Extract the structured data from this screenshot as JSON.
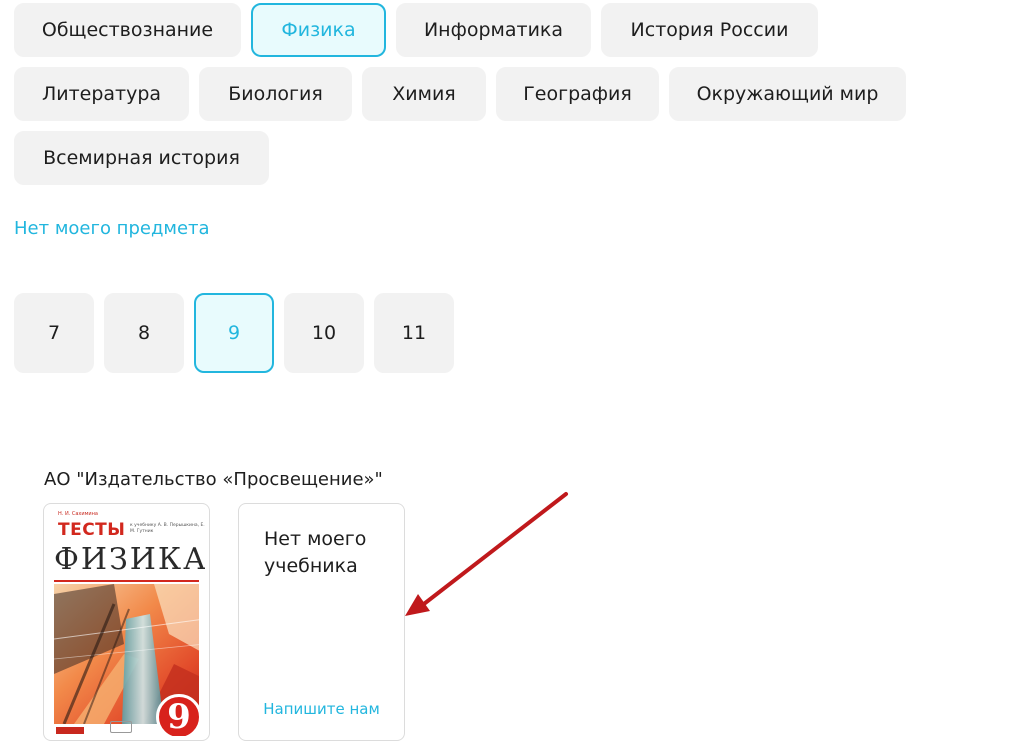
{
  "subjects": [
    {
      "label": "Обществознание",
      "active": false
    },
    {
      "label": "Физика",
      "active": true
    },
    {
      "label": "Информатика",
      "active": false
    },
    {
      "label": "История России",
      "active": false
    },
    {
      "label": "Литература",
      "active": false
    },
    {
      "label": "Биология",
      "active": false
    },
    {
      "label": "Химия",
      "active": false
    },
    {
      "label": "География",
      "active": false
    },
    {
      "label": "Окружающий мир",
      "active": false
    },
    {
      "label": "Всемирная история",
      "active": false
    }
  ],
  "no_subject_link": "Нет моего предмета",
  "grades": [
    {
      "label": "7",
      "active": false
    },
    {
      "label": "8",
      "active": false
    },
    {
      "label": "9",
      "active": true
    },
    {
      "label": "10",
      "active": false
    },
    {
      "label": "11",
      "active": false
    }
  ],
  "publisher": "АО \"Издательство «Просвещение»\"",
  "book": {
    "cover_author": "Н. И. Сахимина",
    "cover_series": "ТЕСТЫ",
    "cover_subtitle": "к учебнику А. В. Перышкина, Е. М. Гутник",
    "cover_title": "ФИЗИКА",
    "cover_grade": "9"
  },
  "no_textbook": {
    "title": "Нет моего учебника",
    "link": "Напишите нам"
  },
  "colors": {
    "accent": "#22b6de",
    "chip_bg": "#f2f2f2",
    "active_bg": "#e8fbfd",
    "annotation_arrow": "#c0191c"
  }
}
